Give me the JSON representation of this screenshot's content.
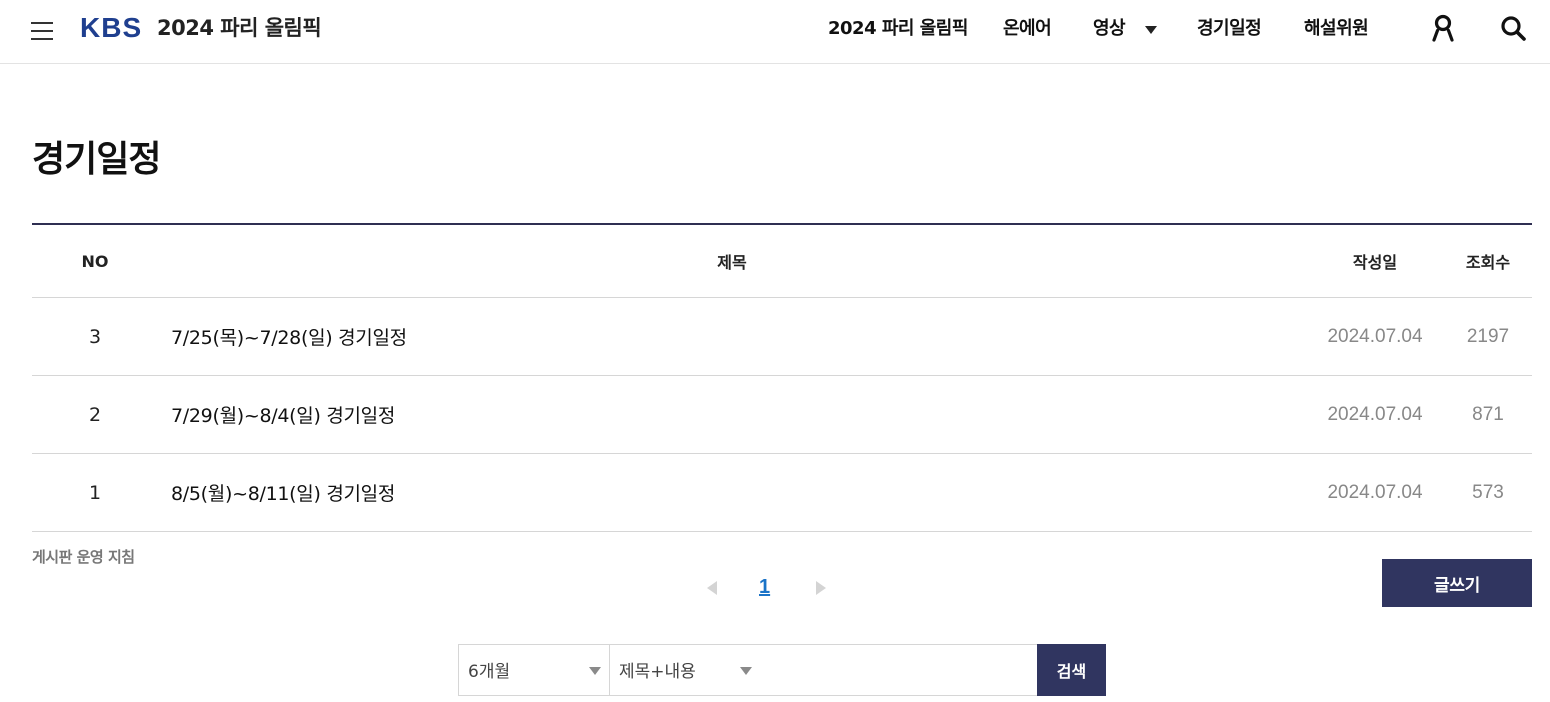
{
  "header": {
    "logo_text": "KBS",
    "site_title": "2024 파리 올림픽",
    "nav_items": [
      {
        "label": "2024 파리 올림픽"
      },
      {
        "label": "온에어"
      },
      {
        "label": "영상"
      },
      {
        "label": "경기일정"
      },
      {
        "label": "해설위원"
      }
    ],
    "icons": {
      "menu": "hamburger-menu-icon",
      "caret": "caret-down-icon",
      "user": "user-icon",
      "search": "search-icon"
    }
  },
  "page": {
    "title": "경기일정"
  },
  "table": {
    "headers": {
      "no": "NO",
      "title": "제목",
      "date": "작성일",
      "views": "조회수"
    },
    "rows": [
      {
        "no": "3",
        "title": "7/25(목)~7/28(일) 경기일정",
        "date": "2024.07.04",
        "views": "2197"
      },
      {
        "no": "2",
        "title": "7/29(월)~8/4(일) 경기일정",
        "date": "2024.07.04",
        "views": "871"
      },
      {
        "no": "1",
        "title": "8/5(월)~8/11(일) 경기일정",
        "date": "2024.07.04",
        "views": "573"
      }
    ]
  },
  "footer": {
    "policy_link": "게시판 운영 지침",
    "write_button": "글쓰기",
    "pagination": {
      "current_page": "1"
    }
  },
  "search": {
    "period_value": "6개월",
    "field_value": "제목+내용",
    "input_value": "",
    "button_label": "검색"
  },
  "colors": {
    "brand": "#1f3f8f",
    "button_bg": "#303560",
    "page_link": "#1a73c7",
    "muted_text": "#888888"
  }
}
